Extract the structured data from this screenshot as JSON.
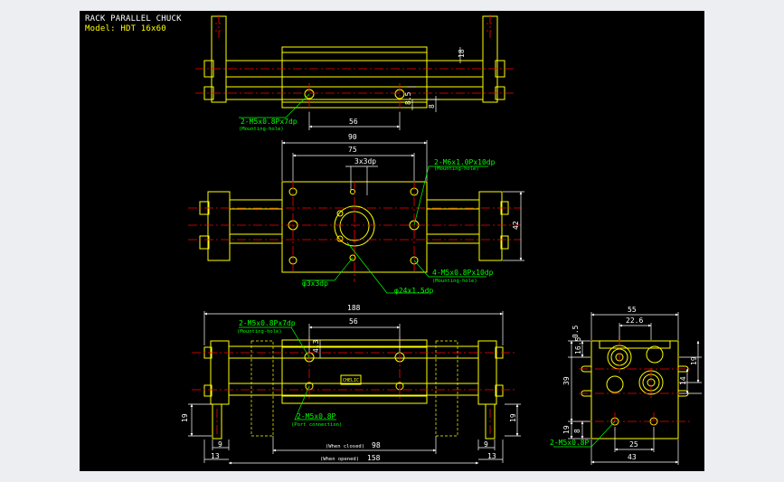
{
  "header": {
    "title": "RACK PARALLEL CHUCK",
    "model": "Model: HDT 16x60"
  },
  "colors": {
    "background": "#000000",
    "outline": "#ffff00",
    "centerline": "#ff0000",
    "dimension": "#ffffff",
    "annotation": "#00ff00",
    "hidden": "#ffff00"
  },
  "top_view": {
    "dims": {
      "bore_pitch": "56",
      "height_18": "18",
      "height_8_5": "8.5",
      "height_8": "8"
    },
    "callout": {
      "spec": "2-M5x0.8Px7dp",
      "note": "(Mounting-hole)"
    }
  },
  "front_view": {
    "dims": {
      "width_90": "90",
      "width_75": "75",
      "height_42": "42"
    },
    "callouts": {
      "pin_hole": "3x3dp",
      "top_right": {
        "spec": "2-M6x1.0Px10dp",
        "note": "(Mounting-hole)"
      },
      "bottom_right": {
        "spec": "4-M5x0.8Px10dp",
        "note": "(Mounting-hole)"
      },
      "pin_bottom": "φ3x3dp",
      "center_bore": "φ24x1.5dp"
    }
  },
  "side_view": {
    "dims": {
      "overall": "188",
      "pitch": "56",
      "height_4_3": "4.3",
      "height_19": "19",
      "foot_left": "9",
      "foot_right": "9",
      "edge_left": "13",
      "edge_right": "13",
      "closed": "98",
      "opened": "158"
    },
    "callouts": {
      "mount": {
        "spec": "2-M5x0.8Px7dp",
        "note": "(Mounting-hole)"
      },
      "port": {
        "spec": "2-M5x0.8P",
        "note": "(Port connection)"
      },
      "closed_label": "(When closed)",
      "opened_label": "(When opened)",
      "badge": "CHELIC"
    }
  },
  "end_view": {
    "dims": {
      "width_55": "55",
      "width_22_6": "22.6",
      "height_0_5": "0.5",
      "height_16_5": "16.5",
      "height_39": "39",
      "height_19_left": "19",
      "height_8": "8",
      "height_19_right": "19",
      "height_14": "14",
      "width_25": "25",
      "width_43": "43"
    },
    "callout": {
      "spec": "2-M5x0.8P"
    }
  }
}
